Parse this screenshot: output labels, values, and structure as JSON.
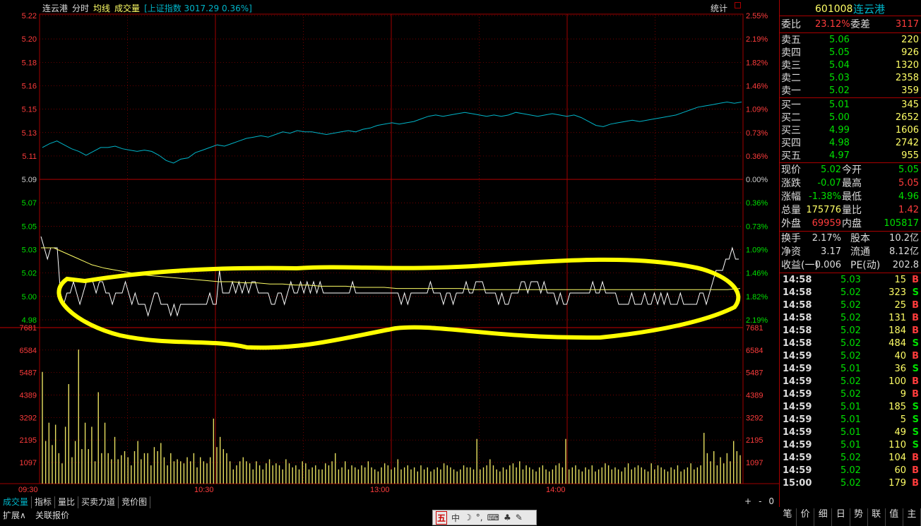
{
  "header": {
    "stock_name": "连云港",
    "tabs": [
      "分时",
      "均线",
      "成交量"
    ],
    "index_label": "[上证指数 3017.29 0.36%]",
    "stat_label": "统计"
  },
  "axes": {
    "price_ticks": [
      "5.22",
      "5.20",
      "5.18",
      "5.16",
      "5.15",
      "5.13",
      "5.11",
      "5.09",
      "5.07",
      "5.05",
      "5.03",
      "5.02",
      "5.00",
      "4.98"
    ],
    "pct_ticks": [
      "2.55%",
      "2.19%",
      "1.82%",
      "1.46%",
      "1.09%",
      "0.73%",
      "0.36%",
      "0.00%",
      "0.36%",
      "0.73%",
      "1.09%",
      "1.46%",
      "1.82%",
      "2.19%"
    ],
    "volume_ticks": [
      "7681",
      "6584",
      "5487",
      "4389",
      "3292",
      "2195",
      "1097"
    ],
    "time_ticks": [
      "09:30",
      "10:30",
      "13:00",
      "14:00"
    ]
  },
  "colors": {
    "up": "#ff3c3c",
    "down": "#00e000",
    "grid": "#a00000",
    "price_line": "#ffffff",
    "avg_line": "#ffff66",
    "index_line": "#00b4c8",
    "volume_bar": "#e8e060",
    "highlight": "#ffff00"
  },
  "chart_data": [
    {
      "type": "line",
      "title": "连云港 分时",
      "ylim": [
        4.98,
        5.22
      ],
      "x_range": [
        "09:30",
        "15:00"
      ],
      "series": [
        {
          "name": "价格",
          "values": [
            5.04,
            5.03,
            5.02,
            5.03,
            5.03,
            5.03,
            4.99,
            4.98,
            4.99,
            4.99,
            5.0,
            4.99,
            4.98,
            4.99,
            5.0,
            5.0,
            5.0,
            4.99,
            5.0,
            5.0,
            4.99,
            4.99,
            4.98,
            4.99,
            4.99,
            4.99,
            5.0,
            4.99,
            4.98,
            4.99,
            4.98,
            4.98,
            4.98,
            4.97,
            4.98,
            4.99,
            4.99,
            4.98,
            4.98,
            4.98,
            4.97,
            4.98,
            4.97,
            4.98,
            4.98,
            4.98,
            4.98,
            4.98,
            4.98,
            4.98,
            4.98,
            4.98,
            4.99,
            4.98,
            4.98,
            5.01,
            4.99,
            4.99,
            4.99,
            5.0,
            4.99,
            5.0,
            4.99,
            5.0,
            4.99,
            5.0,
            5.0,
            4.99,
            4.99,
            4.99,
            4.99,
            4.98,
            4.98,
            4.99,
            4.99,
            4.98,
            4.99,
            5.0,
            4.99,
            4.99,
            5.0,
            4.99,
            5.0,
            4.99,
            5.0,
            4.99,
            5.0,
            4.99,
            4.99,
            4.99,
            4.99,
            4.99,
            4.99,
            4.99,
            4.99,
            4.99,
            5.0,
            4.99,
            4.99,
            4.99,
            4.99,
            4.99,
            4.99,
            4.99,
            4.99,
            4.99,
            4.99,
            4.99,
            4.99,
            4.99,
            4.99,
            4.98,
            4.99,
            4.98,
            4.99,
            4.99,
            4.99,
            4.99,
            4.99,
            4.99,
            5.0,
            4.99,
            4.99,
            4.99,
            4.98,
            4.99,
            4.99,
            4.98,
            4.99,
            4.99,
            4.99,
            5.0,
            4.99,
            4.99,
            5.0,
            5.0,
            5.0,
            4.99,
            4.99,
            4.99,
            4.99,
            4.98,
            4.99,
            4.98,
            4.98,
            4.99,
            4.99,
            4.99,
            5.0,
            5.0,
            4.99,
            5.0,
            5.0,
            5.0,
            4.99,
            5.0,
            4.99,
            4.99,
            4.99,
            4.98,
            4.99,
            4.98,
            4.98,
            4.99,
            4.99,
            4.99,
            4.99,
            4.99,
            4.99,
            4.99,
            5.0,
            4.99,
            4.99,
            5.0,
            4.99,
            4.99,
            4.99,
            4.99,
            4.98,
            4.98,
            4.98,
            4.98,
            4.99,
            4.98,
            4.98,
            4.98,
            4.99,
            4.98,
            4.98,
            4.99,
            4.98,
            4.99,
            4.98,
            4.99,
            4.98,
            4.98,
            4.98,
            4.99,
            4.98,
            4.98,
            4.98,
            4.98,
            4.98,
            4.99,
            4.99,
            4.98,
            4.99,
            5.0,
            5.01,
            5.01,
            5.01,
            5.02,
            5.02,
            5.03,
            5.02,
            5.02
          ]
        },
        {
          "name": "均线",
          "values": [
            5.03,
            5.03,
            5.025,
            5.02,
            5.015,
            5.012,
            5.01,
            5.008,
            5.006,
            5.005,
            5.004,
            5.003,
            5.002,
            5.001,
            5.0,
            5.0,
            4.999,
            4.999,
            4.998,
            4.998,
            4.997,
            4.997,
            4.996,
            4.996,
            4.996,
            4.995,
            4.995,
            4.995,
            4.994,
            4.994,
            4.994,
            4.994,
            4.994,
            4.994,
            4.993,
            4.993,
            4.993,
            4.993,
            4.993,
            4.993,
            4.993,
            4.993,
            4.993,
            4.993,
            4.993,
            4.993,
            4.993,
            4.993,
            4.993,
            4.993,
            4.993,
            4.993,
            4.993,
            4.993,
            4.993,
            4.994
          ]
        }
      ]
    },
    {
      "type": "line",
      "title": "上证指数",
      "series": [
        {
          "name": "上证指数",
          "values": [
            0.36,
            0.42,
            0.46,
            0.4,
            0.34,
            0.3,
            0.24,
            0.3,
            0.36,
            0.36,
            0.38,
            0.34,
            0.32,
            0.3,
            0.32,
            0.3,
            0.24,
            0.16,
            0.12,
            0.18,
            0.2,
            0.28,
            0.32,
            0.36,
            0.4,
            0.38,
            0.42,
            0.46,
            0.5,
            0.52,
            0.54,
            0.52,
            0.56,
            0.6,
            0.58,
            0.62,
            0.6,
            0.6,
            0.58,
            0.56,
            0.58,
            0.6,
            0.62,
            0.6,
            0.64,
            0.66,
            0.7,
            0.72,
            0.74,
            0.72,
            0.74,
            0.76,
            0.8,
            0.84,
            0.86,
            0.84,
            0.86,
            0.88,
            0.9,
            0.88,
            0.86,
            0.84,
            0.86,
            0.84,
            0.86,
            0.9,
            0.88,
            0.86,
            0.84,
            0.86,
            0.88,
            0.86,
            0.84,
            0.86,
            0.82,
            0.76,
            0.7,
            0.68,
            0.72,
            0.74,
            0.76,
            0.78,
            0.76,
            0.78,
            0.8,
            0.82,
            0.84,
            0.86,
            0.9,
            0.94,
            0.98,
            1.0,
            1.02,
            1.04,
            1.06,
            1.04,
            1.06
          ]
        }
      ]
    },
    {
      "type": "bar",
      "title": "成交量",
      "ylim": [
        0,
        7681
      ],
      "values": [
        5500,
        2100,
        3000,
        1900,
        2900,
        1500,
        1000,
        2800,
        4900,
        1300,
        2100,
        6600,
        1700,
        3000,
        1700,
        2800,
        1100,
        4500,
        1500,
        3000,
        1500,
        1200,
        2300,
        1200,
        1400,
        1600,
        1300,
        900,
        1600,
        2100,
        1200,
        1500,
        1500,
        900,
        1800,
        1600,
        2000,
        1300,
        900,
        1500,
        1100,
        1200,
        1100,
        1000,
        1300,
        1100,
        1500,
        800,
        1300,
        1100,
        1000,
        1300,
        3200,
        1800,
        2300,
        1700,
        1500,
        1100,
        700,
        900,
        1100,
        1300,
        1100,
        1000,
        700,
        1100,
        900,
        700,
        1000,
        1200,
        900,
        1000,
        900,
        700,
        1200,
        1000,
        800,
        900,
        700,
        1100,
        1000,
        700,
        800,
        900,
        700,
        700,
        1000,
        900,
        1100,
        1500,
        700,
        800,
        1100,
        700,
        900,
        800,
        700,
        900,
        800,
        1100,
        800,
        700,
        600,
        800,
        1000,
        900,
        700,
        800,
        1200,
        700,
        800,
        900,
        700,
        800,
        600,
        900,
        700,
        800,
        600,
        700,
        800,
        700,
        1000,
        900,
        800,
        700,
        600,
        700,
        900,
        800,
        800,
        700,
        2200,
        700,
        800,
        900,
        1200,
        900,
        700,
        600,
        800,
        700,
        900,
        1000,
        800,
        1100,
        700,
        900,
        800,
        700,
        600,
        800,
        900,
        700,
        600,
        700,
        900,
        1000,
        800,
        2200,
        700,
        800,
        900,
        700,
        600,
        800,
        700,
        900,
        600,
        700,
        800,
        1000,
        900,
        700,
        800,
        700,
        600,
        800,
        1000,
        700,
        800,
        900,
        800,
        700,
        600,
        1000,
        700,
        900,
        800,
        700,
        600,
        800,
        700,
        900,
        600,
        700,
        800,
        1000,
        700,
        800,
        900,
        2500,
        1500,
        1100,
        1600,
        900,
        1300,
        1000,
        1500,
        1100,
        2100,
        1600,
        1400
      ]
    }
  ],
  "panel": {
    "code": "601008",
    "name": "连云港",
    "weibi": {
      "label1": "委比",
      "val1": "23.12%",
      "label2": "委差",
      "val2": "3117"
    },
    "asks": [
      {
        "label": "卖五",
        "price": "5.06",
        "vol": "220"
      },
      {
        "label": "卖四",
        "price": "5.05",
        "vol": "926"
      },
      {
        "label": "卖三",
        "price": "5.04",
        "vol": "1320"
      },
      {
        "label": "卖二",
        "price": "5.03",
        "vol": "2358"
      },
      {
        "label": "卖一",
        "price": "5.02",
        "vol": "359"
      }
    ],
    "bids": [
      {
        "label": "买一",
        "price": "5.01",
        "vol": "345"
      },
      {
        "label": "买二",
        "price": "5.00",
        "vol": "2652"
      },
      {
        "label": "买三",
        "price": "4.99",
        "vol": "1606"
      },
      {
        "label": "买四",
        "price": "4.98",
        "vol": "2742"
      },
      {
        "label": "买五",
        "price": "4.97",
        "vol": "955"
      }
    ],
    "quote": [
      {
        "l1": "现价",
        "v1": "5.02",
        "l2": "今开",
        "v2": "5.05"
      },
      {
        "l1": "涨跌",
        "v1": "-0.07",
        "l2": "最高",
        "v2": "5.05"
      },
      {
        "l1": "涨幅",
        "v1": "-1.38%",
        "l2": "最低",
        "v2": "4.96"
      },
      {
        "l1": "总量",
        "v1": "175776",
        "l2": "量比",
        "v2": "1.42"
      },
      {
        "l1": "外盘",
        "v1": "69959",
        "l2": "内盘",
        "v2": "105817"
      }
    ],
    "finance": [
      {
        "l1": "换手",
        "v1": "2.17%",
        "l2": "股本",
        "v2": "10.2亿"
      },
      {
        "l1": "净资",
        "v1": "3.17",
        "l2": "流通",
        "v2": "8.12亿"
      },
      {
        "l1": "收益(一)",
        "v1": "0.006",
        "l2": "PE(动)",
        "v2": "202.8"
      }
    ],
    "ticks": [
      {
        "time": "14:58",
        "price": "5.03",
        "vol": "15",
        "side": "B"
      },
      {
        "time": "14:58",
        "price": "5.02",
        "vol": "323",
        "side": "S"
      },
      {
        "time": "14:58",
        "price": "5.02",
        "vol": "25",
        "side": "B"
      },
      {
        "time": "14:58",
        "price": "5.02",
        "vol": "131",
        "side": "B"
      },
      {
        "time": "14:58",
        "price": "5.02",
        "vol": "184",
        "side": "B"
      },
      {
        "time": "14:58",
        "price": "5.02",
        "vol": "484",
        "side": "S"
      },
      {
        "time": "14:59",
        "price": "5.02",
        "vol": "40",
        "side": "B"
      },
      {
        "time": "14:59",
        "price": "5.01",
        "vol": "36",
        "side": "S"
      },
      {
        "time": "14:59",
        "price": "5.02",
        "vol": "100",
        "side": "B"
      },
      {
        "time": "14:59",
        "price": "5.02",
        "vol": "9",
        "side": "B"
      },
      {
        "time": "14:59",
        "price": "5.01",
        "vol": "185",
        "side": "S"
      },
      {
        "time": "14:59",
        "price": "5.01",
        "vol": "5",
        "side": "S"
      },
      {
        "time": "14:59",
        "price": "5.01",
        "vol": "49",
        "side": "S"
      },
      {
        "time": "14:59",
        "price": "5.01",
        "vol": "110",
        "side": "S"
      },
      {
        "time": "14:59",
        "price": "5.02",
        "vol": "104",
        "side": "B"
      },
      {
        "time": "14:59",
        "price": "5.02",
        "vol": "60",
        "side": "B"
      },
      {
        "time": "15:00",
        "price": "5.02",
        "vol": "179",
        "side": "B"
      }
    ],
    "tabs": [
      "笔",
      "价",
      "细",
      "日",
      "势",
      "联",
      "值",
      "主"
    ]
  },
  "bottom_tabs": [
    "成交量",
    "指标",
    "量比",
    "买卖力道",
    "竞价图"
  ],
  "zoom_buttons": [
    "+",
    "-",
    "0"
  ],
  "ext_row": [
    "扩展∧",
    "关联报价"
  ],
  "ime_bar": [
    "五",
    "中",
    "☽",
    "°,",
    "⌨",
    "♣",
    "✎"
  ]
}
